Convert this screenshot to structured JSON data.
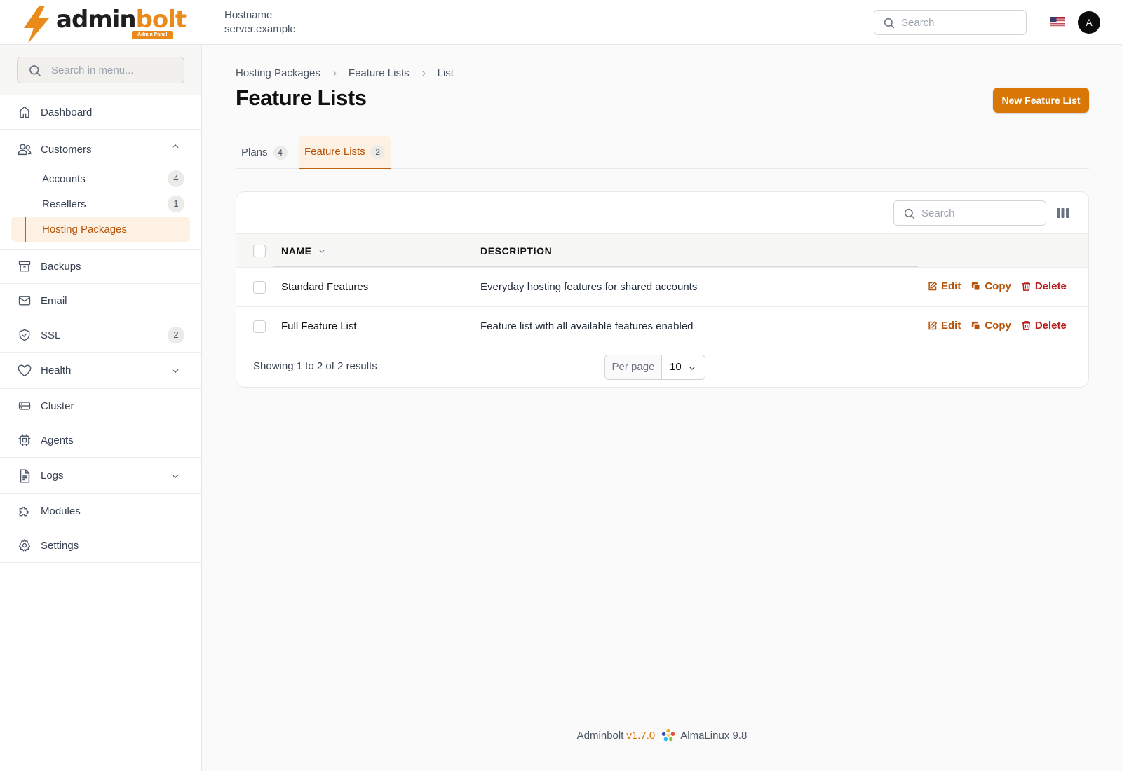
{
  "header": {
    "logo": {
      "text_a": "admin",
      "text_b": "bolt",
      "badge": "Admin Panel"
    },
    "hostname_label": "Hostname",
    "hostname_value": "server.example",
    "search_placeholder": "Search",
    "avatar_initial": "A",
    "flag_icon": "us-flag-icon"
  },
  "sidebar": {
    "search_placeholder": "Search in menu...",
    "items": [
      {
        "label": "Dashboard",
        "icon": "home-icon"
      },
      {
        "label": "Customers",
        "icon": "users-icon",
        "expanded": true,
        "children": [
          {
            "label": "Accounts",
            "badge": "4"
          },
          {
            "label": "Resellers",
            "badge": "1"
          },
          {
            "label": "Hosting Packages",
            "active": true
          }
        ]
      },
      {
        "label": "Backups",
        "icon": "archive-icon"
      },
      {
        "label": "Email",
        "icon": "mail-icon"
      },
      {
        "label": "SSL",
        "icon": "shield-check-icon",
        "badge": "2"
      },
      {
        "label": "Health",
        "icon": "heart-icon",
        "collapsible": true
      },
      {
        "label": "Cluster",
        "icon": "server-icon"
      },
      {
        "label": "Agents",
        "icon": "cpu-icon"
      },
      {
        "label": "Logs",
        "icon": "document-icon",
        "collapsible": true
      },
      {
        "label": "Modules",
        "icon": "puzzle-icon"
      },
      {
        "label": "Settings",
        "icon": "gear-icon"
      }
    ]
  },
  "breadcrumb": [
    "Hosting Packages",
    "Feature Lists",
    "List"
  ],
  "page_title": "Feature Lists",
  "new_button_label": "New Feature List",
  "tabs": [
    {
      "label": "Plans",
      "count": "4"
    },
    {
      "label": "Feature Lists",
      "count": "2",
      "active": true
    }
  ],
  "table": {
    "search_placeholder": "Search",
    "columns": [
      "NAME",
      "DESCRIPTION"
    ],
    "rows": [
      {
        "name": "Standard Features",
        "description": "Everyday hosting features for shared accounts"
      },
      {
        "name": "Full Feature List",
        "description": "Feature list with all available features enabled"
      }
    ],
    "actions": {
      "edit": "Edit",
      "copy": "Copy",
      "delete": "Delete"
    },
    "showing": "Showing 1 to 2 of 2 results",
    "per_page_label": "Per page",
    "per_page_value": "10"
  },
  "footer": {
    "product": "Adminbolt",
    "version": "v1.7.0",
    "os": "AlmaLinux 9.8"
  },
  "colors": {
    "accent": "#d97706",
    "accent_text": "#b45309",
    "danger": "#b91c1c",
    "active_bg": "#fdf1e4"
  }
}
